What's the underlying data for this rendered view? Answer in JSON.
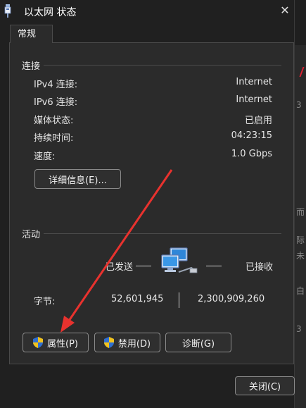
{
  "window": {
    "title": "以太网 状态",
    "close_glyph": "✕",
    "tab_label": "常规"
  },
  "connection": {
    "section_label": "连接",
    "rows": [
      {
        "label": "IPv4 连接:",
        "value": "Internet"
      },
      {
        "label": "IPv6 连接:",
        "value": "Internet"
      },
      {
        "label": "媒体状态:",
        "value": "已启用"
      },
      {
        "label": "持续时间:",
        "value": "04:23:15"
      },
      {
        "label": "速度:",
        "value": "1.0 Gbps"
      }
    ],
    "details_button": "详细信息(E)..."
  },
  "activity": {
    "section_label": "活动",
    "sent_label": "已发送",
    "received_label": "已接收",
    "bytes_label": "字节:",
    "bytes_sent": "52,601,945",
    "bytes_received": "2,300,909,260"
  },
  "buttons": {
    "properties": "属性(P)",
    "disable": "禁用(D)",
    "diagnose": "诊断(G)",
    "close": "关闭(C)"
  },
  "colors": {
    "annotation_arrow": "#e8322e",
    "shield_blue": "#2f6fd1",
    "shield_yellow": "#f2c21b"
  },
  "icons": [
    "network-adapter-icon",
    "shield-icon",
    "network-computers-icon",
    "close-icon"
  ]
}
